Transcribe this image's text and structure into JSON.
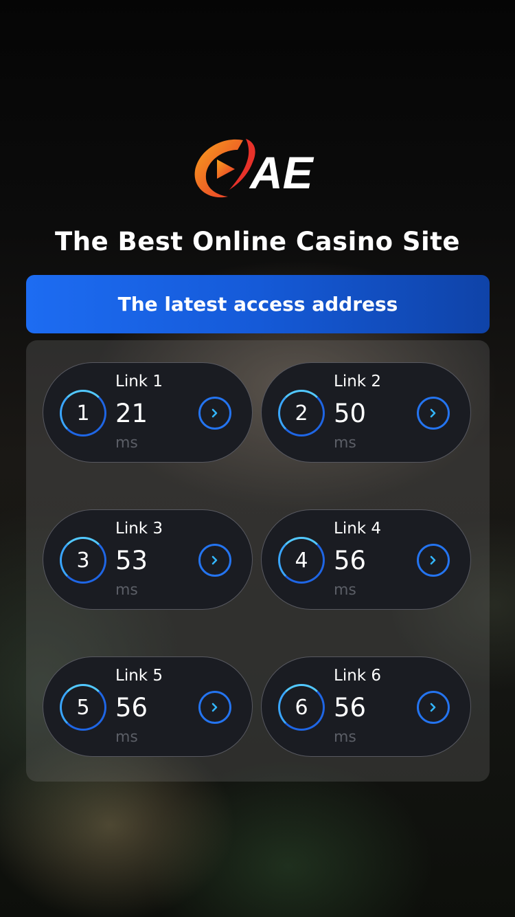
{
  "brand": {
    "logo_text": "AE",
    "colors": {
      "accent_blue": "#1d6cf2",
      "logo_red": "#e8322a",
      "logo_orange": "#f59a1c"
    }
  },
  "headline": "The Best Online Casino Site",
  "access_banner": {
    "label": "The latest access address"
  },
  "links": [
    {
      "number": "1",
      "label": "Link 1",
      "latency": "21",
      "unit": "ms"
    },
    {
      "number": "2",
      "label": "Link 2",
      "latency": "50",
      "unit": "ms"
    },
    {
      "number": "3",
      "label": "Link 3",
      "latency": "53",
      "unit": "ms"
    },
    {
      "number": "4",
      "label": "Link 4",
      "latency": "56",
      "unit": "ms"
    },
    {
      "number": "5",
      "label": "Link 5",
      "latency": "56",
      "unit": "ms"
    },
    {
      "number": "6",
      "label": "Link 6",
      "latency": "56",
      "unit": "ms"
    }
  ],
  "icons": {
    "go": "chevron-right-icon"
  }
}
